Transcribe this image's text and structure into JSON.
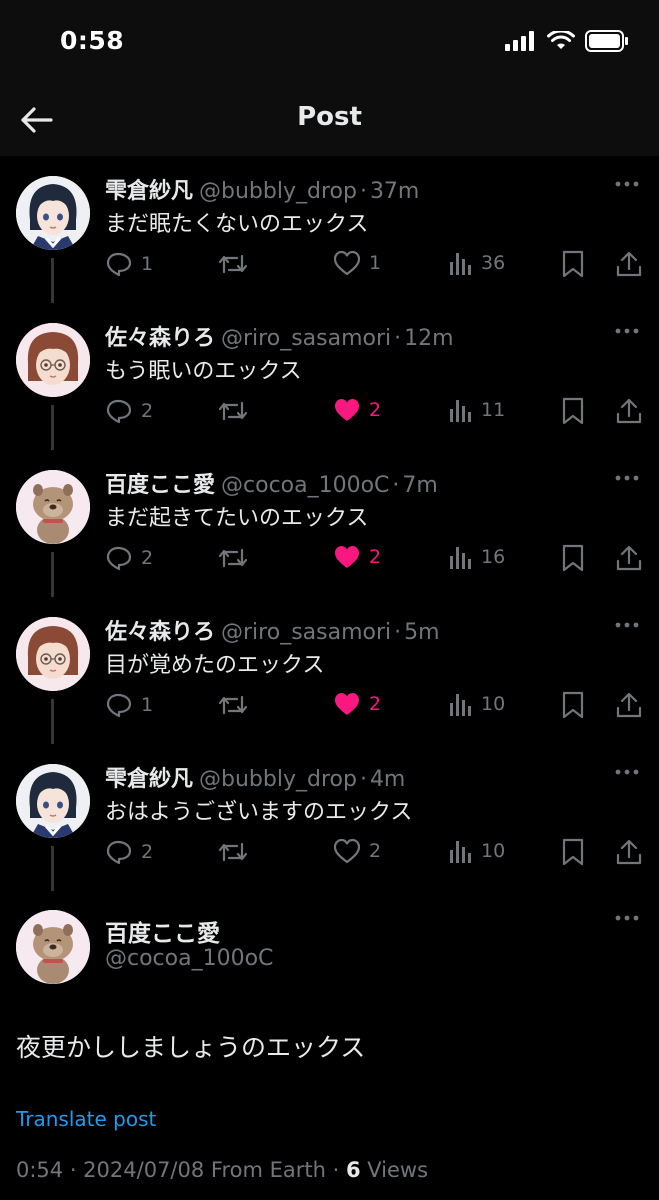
{
  "status_bar": {
    "time": "0:58"
  },
  "header": {
    "title": "Post"
  },
  "thread": [
    {
      "name": "雫倉紗凡",
      "handle": "@bubbly_drop",
      "time": "37m",
      "text": "まだ眠たくないのエックス",
      "replies": "1",
      "reposts": "",
      "likes": "1",
      "views": "36",
      "liked": false,
      "avatar": "anime-girl-dark-hair"
    },
    {
      "name": "佐々森りろ",
      "handle": "@riro_sasamori",
      "time": "12m",
      "text": "もう眠いのエックス",
      "replies": "2",
      "reposts": "",
      "likes": "2",
      "views": "11",
      "liked": true,
      "avatar": "anime-girl-glasses"
    },
    {
      "name": "百度ここ愛",
      "handle": "@cocoa_100oC",
      "time": "7m",
      "text": "まだ起きてたいのエックス",
      "replies": "2",
      "reposts": "",
      "likes": "2",
      "views": "16",
      "liked": true,
      "avatar": "brown-dog"
    },
    {
      "name": "佐々森りろ",
      "handle": "@riro_sasamori",
      "time": "5m",
      "text": "目が覚めたのエックス",
      "replies": "1",
      "reposts": "",
      "likes": "2",
      "views": "10",
      "liked": true,
      "avatar": "anime-girl-glasses"
    },
    {
      "name": "雫倉紗凡",
      "handle": "@bubbly_drop",
      "time": "4m",
      "text": "おはようございますのエックス",
      "replies": "2",
      "reposts": "",
      "likes": "2",
      "views": "10",
      "liked": false,
      "avatar": "anime-girl-dark-hair"
    }
  ],
  "main_post": {
    "name": "百度ここ愛",
    "handle": "@cocoa_100oC",
    "text": "夜更かししましょうのエックス",
    "translate_label": "Translate post",
    "meta_prefix": "0:54 · 2024/07/08 From Earth · ",
    "views_count": "6",
    "views_label": " Views",
    "avatar": "brown-dog"
  },
  "colors": {
    "like": "#f91880",
    "link": "#1d9bf0",
    "muted": "#71767b"
  }
}
